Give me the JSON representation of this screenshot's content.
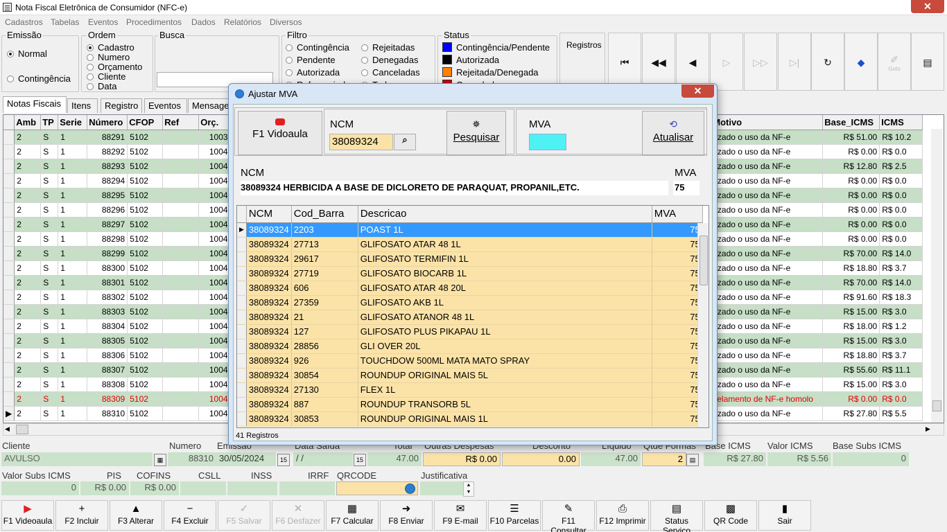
{
  "window": {
    "title": "Nota Fiscal Eletrônica de Consumidor (NFC-e)",
    "close": "✕"
  },
  "menu": [
    "Cadastros",
    "Tabelas",
    "Eventos",
    "Procedimentos",
    "Dados",
    "Relatórios",
    "Diversos"
  ],
  "emissao": {
    "label": "Emissão",
    "options": [
      "Normal",
      "Contingência"
    ]
  },
  "ordem": {
    "label": "Ordem",
    "options": [
      "Cadastro",
      "Numero",
      "Orçamento",
      "Cliente",
      "Data"
    ]
  },
  "busca": {
    "label": "Busca",
    "value": ""
  },
  "filtro": {
    "label": "Filtro",
    "col1": [
      "Contingência",
      "Pendente",
      "Autorizada",
      "Referenciadas"
    ],
    "col2": [
      "Rejeitadas",
      "Denegadas",
      "Canceladas",
      "Todas"
    ]
  },
  "status": {
    "label": "Status",
    "items": [
      {
        "label": "Contingência/Pendente",
        "color": "#0000ff"
      },
      {
        "label": "Autorizada",
        "color": "#000000"
      },
      {
        "label": "Rejeitada/Denegada",
        "color": "#ff8000"
      },
      {
        "label": "Cancelada",
        "color": "#cc0000"
      }
    ]
  },
  "registros_label": "Registros",
  "toolbar_icons": [
    "first-icon",
    "rewind-icon",
    "prev-icon",
    "next-icon",
    "fast-forward-icon",
    "last-icon",
    "refresh-icon",
    "tag-icon",
    "goto-icon",
    "notes-icon"
  ],
  "goto_label": "Goto",
  "tabs": [
    "Notas Fiscais",
    "Itens",
    "Registro",
    "Eventos",
    "Mensagem"
  ],
  "grid": {
    "columns": [
      "Amb",
      "TP",
      "Serie",
      "Número",
      "CFOP",
      "Ref",
      "Orç.",
      "Motivo",
      "Base_ICMS",
      "ICMS"
    ],
    "rows": [
      {
        "amb": "2",
        "tp": "S",
        "serie": "1",
        "numero": "88291",
        "cfop": "5102",
        "ref": "",
        "orc": "10039",
        "motivo": "rizado o uso da NF-e",
        "base": "R$ 51.00",
        "icms": "R$ 10.2"
      },
      {
        "amb": "2",
        "tp": "S",
        "serie": "1",
        "numero": "88292",
        "cfop": "5102",
        "ref": "",
        "orc": "10040",
        "motivo": "rizado o uso da NF-e",
        "base": "R$ 0.00",
        "icms": "R$ 0.0"
      },
      {
        "amb": "2",
        "tp": "S",
        "serie": "1",
        "numero": "88293",
        "cfop": "5102",
        "ref": "",
        "orc": "10040",
        "motivo": "rizado o uso da NF-e",
        "base": "R$ 12.80",
        "icms": "R$ 2.5"
      },
      {
        "amb": "2",
        "tp": "S",
        "serie": "1",
        "numero": "88294",
        "cfop": "5102",
        "ref": "",
        "orc": "10040",
        "motivo": "rizado o uso da NF-e",
        "base": "R$ 0.00",
        "icms": "R$ 0.0"
      },
      {
        "amb": "2",
        "tp": "S",
        "serie": "1",
        "numero": "88295",
        "cfop": "5102",
        "ref": "",
        "orc": "10040",
        "motivo": "rizado o uso da NF-e",
        "base": "R$ 0.00",
        "icms": "R$ 0.0"
      },
      {
        "amb": "2",
        "tp": "S",
        "serie": "1",
        "numero": "88296",
        "cfop": "5102",
        "ref": "",
        "orc": "10040",
        "motivo": "rizado o uso da NF-e",
        "base": "R$ 0.00",
        "icms": "R$ 0.0"
      },
      {
        "amb": "2",
        "tp": "S",
        "serie": "1",
        "numero": "88297",
        "cfop": "5102",
        "ref": "",
        "orc": "10041",
        "motivo": "rizado o uso da NF-e",
        "base": "R$ 0.00",
        "icms": "R$ 0.0"
      },
      {
        "amb": "2",
        "tp": "S",
        "serie": "1",
        "numero": "88298",
        "cfop": "5102",
        "ref": "",
        "orc": "10042",
        "motivo": "rizado o uso da NF-e",
        "base": "R$ 0.00",
        "icms": "R$ 0.0"
      },
      {
        "amb": "2",
        "tp": "S",
        "serie": "1",
        "numero": "88299",
        "cfop": "5102",
        "ref": "",
        "orc": "10042",
        "motivo": "rizado o uso da NF-e",
        "base": "R$ 70.00",
        "icms": "R$ 14.0"
      },
      {
        "amb": "2",
        "tp": "S",
        "serie": "1",
        "numero": "88300",
        "cfop": "5102",
        "ref": "",
        "orc": "10042",
        "motivo": "rizado o uso da NF-e",
        "base": "R$ 18.80",
        "icms": "R$ 3.7"
      },
      {
        "amb": "2",
        "tp": "S",
        "serie": "1",
        "numero": "88301",
        "cfop": "5102",
        "ref": "",
        "orc": "10042",
        "motivo": "rizado o uso da NF-e",
        "base": "R$ 70.00",
        "icms": "R$ 14.0"
      },
      {
        "amb": "2",
        "tp": "S",
        "serie": "1",
        "numero": "88302",
        "cfop": "5102",
        "ref": "",
        "orc": "10043",
        "motivo": "rizado o uso da NF-e",
        "base": "R$ 91.60",
        "icms": "R$ 18.3"
      },
      {
        "amb": "2",
        "tp": "S",
        "serie": "1",
        "numero": "88303",
        "cfop": "5102",
        "ref": "",
        "orc": "10044",
        "motivo": "rizado o uso da NF-e",
        "base": "R$ 15.00",
        "icms": "R$ 3.0"
      },
      {
        "amb": "2",
        "tp": "S",
        "serie": "1",
        "numero": "88304",
        "cfop": "5102",
        "ref": "",
        "orc": "10044",
        "motivo": "rizado o uso da NF-e",
        "base": "R$ 18.00",
        "icms": "R$ 1.2"
      },
      {
        "amb": "2",
        "tp": "S",
        "serie": "1",
        "numero": "88305",
        "cfop": "5102",
        "ref": "",
        "orc": "10045",
        "motivo": "rizado o uso da NF-e",
        "base": "R$ 15.00",
        "icms": "R$ 3.0"
      },
      {
        "amb": "2",
        "tp": "S",
        "serie": "1",
        "numero": "88306",
        "cfop": "5102",
        "ref": "",
        "orc": "10045",
        "motivo": "rizado o uso da NF-e",
        "base": "R$ 18.80",
        "icms": "R$ 3.7"
      },
      {
        "amb": "2",
        "tp": "S",
        "serie": "1",
        "numero": "88307",
        "cfop": "5102",
        "ref": "",
        "orc": "10045",
        "motivo": "rizado o uso da NF-e",
        "base": "R$ 55.60",
        "icms": "R$ 11.1"
      },
      {
        "amb": "2",
        "tp": "S",
        "serie": "1",
        "numero": "88308",
        "cfop": "5102",
        "ref": "",
        "orc": "10045",
        "motivo": "rizado o uso da NF-e",
        "base": "R$ 15.00",
        "icms": "R$ 3.0"
      },
      {
        "amb": "2",
        "tp": "S",
        "serie": "1",
        "numero": "88309",
        "cfop": "5102",
        "ref": "",
        "orc": "10046",
        "motivo": "celamento de NF-e homolo",
        "base": "R$ 0.00",
        "icms": "R$ 0.0"
      },
      {
        "amb": "2",
        "tp": "S",
        "serie": "1",
        "numero": "88310",
        "cfop": "5102",
        "ref": "",
        "orc": "10046",
        "motivo": "rizado o uso da NF-e",
        "base": "R$ 27.80",
        "icms": "R$ 5.5"
      }
    ]
  },
  "footer": {
    "cliente_label": "Cliente",
    "cliente": "AVULSO",
    "numero_label": "Numero",
    "numero": "88310",
    "emissao_label": "Emissão",
    "emissao": "30/05/2024",
    "saida_label": "Data Saída",
    "saida": "/ /",
    "total_label": "Total",
    "total": "47.00",
    "outras_label": "Outras Despesas",
    "outras": "R$ 0.00",
    "desconto_label": "Desconto",
    "desconto": "0.00",
    "liquido_label": "Líquido",
    "liquido": "47.00",
    "formas_label": "Qtde Formas",
    "formas": "2",
    "base_icms_label": "Base ICMS",
    "base_icms": "R$ 27.80",
    "valor_icms_label": "Valor ICMS",
    "valor_icms": "R$ 5.56",
    "base_subs_label": "Base Subs ICMS",
    "base_subs": "0",
    "valor_subs_label": "Valor Subs ICMS",
    "valor_subs": "0",
    "pis_label": "PIS",
    "pis": "R$ 0.00",
    "cofins_label": "COFINS",
    "cofins": "R$ 0.00",
    "csll_label": "CSLL",
    "csll": "",
    "inss_label": "INSS",
    "inss": "",
    "irrf_label": "IRRF",
    "irrf": "",
    "qrcode_label": "QRCODE",
    "qrcode": "",
    "justificativa_label": "Justificativa",
    "justificativa": ""
  },
  "fkeys": [
    {
      "label": "F1 Videoaula",
      "icon": "youtube-icon",
      "glyph": "▶",
      "enabled": true
    },
    {
      "label": "F2 Incluir",
      "icon": "plus-icon",
      "glyph": "+",
      "enabled": true
    },
    {
      "label": "F3 Alterar",
      "icon": "triangle-up-icon",
      "glyph": "▲",
      "enabled": true
    },
    {
      "label": "F4 Excluir",
      "icon": "minus-icon",
      "glyph": "−",
      "enabled": true
    },
    {
      "label": "F5 Salvar",
      "icon": "check-icon",
      "glyph": "✓",
      "enabled": false
    },
    {
      "label": "F6 Desfazer",
      "icon": "x-icon",
      "glyph": "✕",
      "enabled": false
    },
    {
      "label": "F7 Calcular",
      "icon": "calculator-icon",
      "glyph": "▦",
      "enabled": true
    },
    {
      "label": "F8 Enviar",
      "icon": "send-icon",
      "glyph": "➜",
      "enabled": true
    },
    {
      "label": "F9 E-mail",
      "icon": "email-icon",
      "glyph": "✉",
      "enabled": true
    },
    {
      "label": "F10 Parcelas",
      "icon": "list-icon",
      "glyph": "☰",
      "enabled": true
    },
    {
      "label": "F11 Consultar",
      "icon": "consult-icon",
      "glyph": "✎",
      "enabled": true
    },
    {
      "label": "F12 Imprimir",
      "icon": "printer-icon",
      "glyph": "⎙",
      "enabled": true
    },
    {
      "label": "Status Serviço",
      "icon": "server-status-icon",
      "glyph": "▤",
      "enabled": true
    },
    {
      "label": "QR Code",
      "icon": "qrcode-icon",
      "glyph": "▩",
      "enabled": true
    },
    {
      "label": "Sair",
      "icon": "exit-icon",
      "glyph": "▮",
      "enabled": true
    }
  ],
  "dialog": {
    "title": "Ajustar MVA",
    "close": "✕",
    "videoaula_label": "F1 Vidoaula",
    "ncm_label": "NCM",
    "ncm_value": "38089324",
    "pesquisar_label": "Pesquisar",
    "mva_label": "MVA",
    "mva_value": "",
    "atualisar_label": "Atualisar",
    "info_ncm_label": "NCM",
    "info_ncm_desc": "38089324 HERBICIDA A BASE DE DICLORETO DE PARAQUAT, PROPANIL,ETC.",
    "info_mva_label": "MVA",
    "info_mva_value": "75",
    "columns": [
      "NCM",
      "Cod_Barra",
      "Descricao",
      "MVA"
    ],
    "rows": [
      {
        "ncm": "38089324",
        "cod": "2203",
        "desc": "POAST 1L",
        "mva": "75"
      },
      {
        "ncm": "38089324",
        "cod": "27713",
        "desc": "GLIFOSATO ATAR 48 1L",
        "mva": "75"
      },
      {
        "ncm": "38089324",
        "cod": "29617",
        "desc": "GLIFOSATO TERMIFIN 1L",
        "mva": "75"
      },
      {
        "ncm": "38089324",
        "cod": "27719",
        "desc": "GLIFOSATO BIOCARB 1L",
        "mva": "75"
      },
      {
        "ncm": "38089324",
        "cod": "606",
        "desc": "GLIFOSATO ATAR 48 20L",
        "mva": "75"
      },
      {
        "ncm": "38089324",
        "cod": "27359",
        "desc": "GLIFOSATO AKB 1L",
        "mva": "75"
      },
      {
        "ncm": "38089324",
        "cod": "21",
        "desc": "GLIFOSATO ATANOR 48 1L",
        "mva": "75"
      },
      {
        "ncm": "38089324",
        "cod": "127",
        "desc": "GLIFOSATO PLUS PIKAPAU 1L",
        "mva": "75"
      },
      {
        "ncm": "38089324",
        "cod": "28856",
        "desc": "GLI OVER 20L",
        "mva": "75"
      },
      {
        "ncm": "38089324",
        "cod": "926",
        "desc": "TOUCHDOW 500ML MATA MATO SPRAY",
        "mva": "75"
      },
      {
        "ncm": "38089324",
        "cod": "30854",
        "desc": "ROUNDUP ORIGINAL MAIS 5L",
        "mva": "75"
      },
      {
        "ncm": "38089324",
        "cod": "27130",
        "desc": "FLEX 1L",
        "mva": "75"
      },
      {
        "ncm": "38089324",
        "cod": "887",
        "desc": "ROUNDUP TRANSORB 5L",
        "mva": "75"
      },
      {
        "ncm": "38089324",
        "cod": "30853",
        "desc": "ROUNDUP ORIGINAL MAIS 1L",
        "mva": "75"
      }
    ],
    "status": "41 Registros"
  }
}
